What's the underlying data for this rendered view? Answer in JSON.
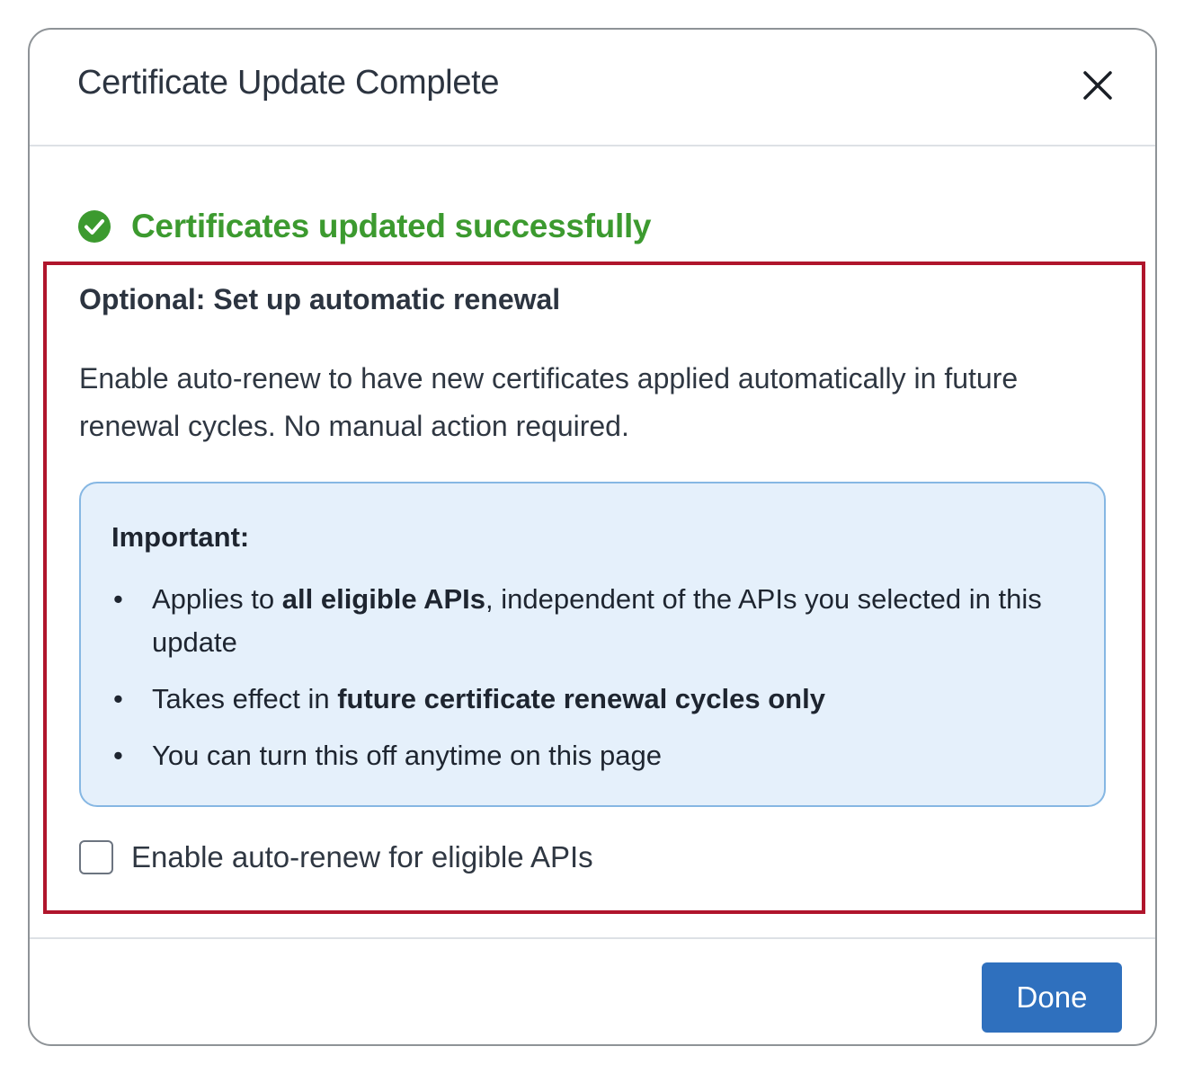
{
  "dialog": {
    "title": "Certificate Update Complete",
    "close_icon": "close-icon"
  },
  "status": {
    "icon": "check-circle-icon",
    "message": "Certificates updated successfully",
    "color": "#3c9a2f"
  },
  "renewal": {
    "heading": "Optional: Set up automatic renewal",
    "description": "Enable auto-renew to have new certificates applied automatically in future renewal cycles. No manual action required.",
    "important": {
      "heading": "Important:",
      "bullet_glyph": "•",
      "bullets": [
        {
          "before": "Applies to ",
          "bold": "all eligible APIs",
          "after": ", independent of the APIs you selected in this update"
        },
        {
          "before": "Takes effect in ",
          "bold": "future certificate renewal cycles only",
          "after": ""
        },
        {
          "before": "You can turn this off anytime on this page",
          "bold": "",
          "after": ""
        }
      ]
    },
    "checkbox": {
      "label": "Enable auto-renew for eligible APIs",
      "checked": false
    }
  },
  "footer": {
    "done_label": "Done"
  },
  "colors": {
    "highlight_border": "#b0152c",
    "info_background": "#e5f0fb",
    "info_border": "#86b7e3",
    "primary_button": "#2f70be"
  }
}
